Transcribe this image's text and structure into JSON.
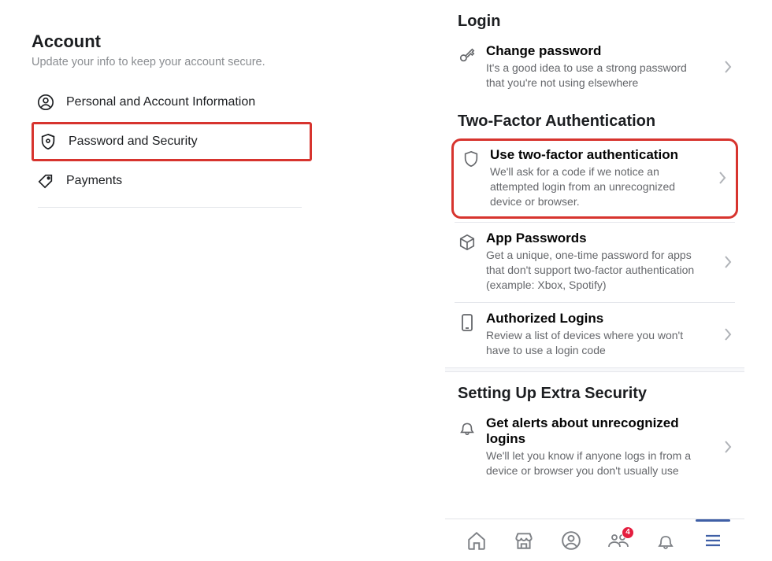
{
  "left": {
    "title": "Account",
    "subtitle": "Update your info to keep your account secure.",
    "items": [
      {
        "label": "Personal and Account Information",
        "icon": "user-circle-icon"
      },
      {
        "label": "Password and Security",
        "icon": "shield-icon",
        "highlight": true
      },
      {
        "label": "Payments",
        "icon": "tag-icon"
      }
    ]
  },
  "right": {
    "sections": [
      {
        "header": "Login",
        "rows": [
          {
            "title": "Change password",
            "desc": "It's a good idea to use a strong password that you're not using elsewhere",
            "icon": "key-icon"
          }
        ]
      },
      {
        "header": "Two-Factor Authentication",
        "rows": [
          {
            "title": "Use two-factor authentication",
            "desc": "We'll ask for a code if we notice an attempted login from an unrecognized device or browser.",
            "icon": "shield-icon",
            "highlight": true
          },
          {
            "title": "App Passwords",
            "desc": "Get a unique, one-time password for apps that don't support two-factor authentication (example: Xbox, Spotify)",
            "icon": "cube-icon"
          },
          {
            "title": "Authorized Logins",
            "desc": "Review a list of devices where you won't have to use a login code",
            "icon": "phone-icon"
          }
        ]
      },
      {
        "header": "Setting Up Extra Security",
        "rows": [
          {
            "title": "Get alerts about unrecognized logins",
            "desc": "We'll let you know if anyone logs in from a device or browser you don't usually use",
            "icon": "bell-icon"
          }
        ]
      }
    ]
  },
  "tabbar": {
    "items": [
      {
        "name": "home-tab",
        "icon": "home-icon"
      },
      {
        "name": "marketplace-tab",
        "icon": "store-icon"
      },
      {
        "name": "profile-tab",
        "icon": "user-circle-icon"
      },
      {
        "name": "groups-tab",
        "icon": "groups-icon",
        "badge": "4"
      },
      {
        "name": "notifications-tab",
        "icon": "bell-icon"
      },
      {
        "name": "menu-tab",
        "icon": "menu-icon",
        "active": true
      }
    ]
  }
}
